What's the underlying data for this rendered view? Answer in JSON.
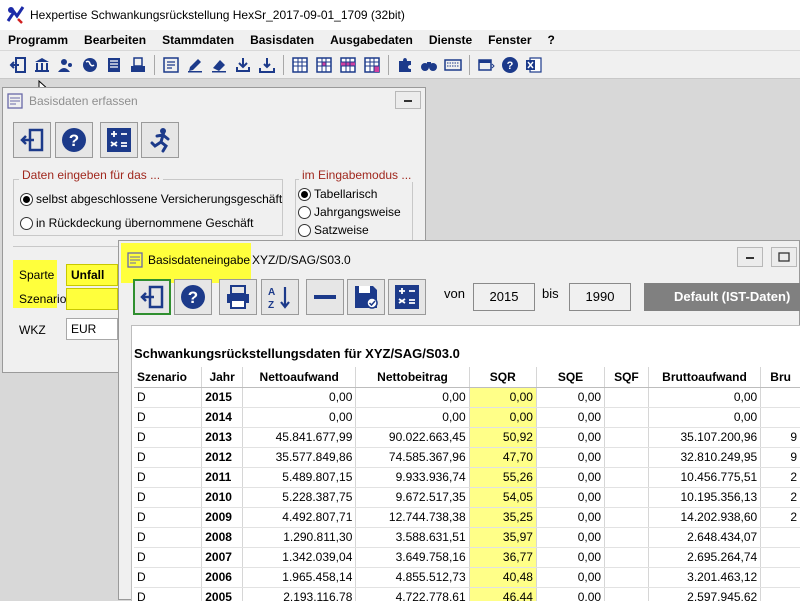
{
  "app": {
    "title": "Hexpertise Schwankungsrückstellung HexSr_2017-09-01_1709 (32bit)"
  },
  "menu": [
    "Programm",
    "Bearbeiten",
    "Stammdaten",
    "Basisdaten",
    "Ausgabedaten",
    "Dienste",
    "Fenster",
    "?"
  ],
  "toolbar": {
    "icons": [
      "exit-icon",
      "bank-icon",
      "users-icon",
      "globe-icon",
      "document-list-icon",
      "printer-doc-icon",
      "form-edit-icon",
      "pencil-edit-icon",
      "eraser-icon",
      "download-icon",
      "import-icon",
      "grid-icon",
      "grid-pink-icon",
      "grid-alt-icon",
      "grid-check-icon",
      "puzzle-icon",
      "binoculars-icon",
      "keyboard-icon",
      "window-icon",
      "help-icon",
      "excel-icon"
    ]
  },
  "win1": {
    "title": "Basisdaten erfassen",
    "group_left": {
      "title": "Daten eingeben für das ...",
      "opt1": "selbst abgeschlossene Versicherungsgeschäft",
      "opt2": "in Rückdeckung übernommene Geschäft",
      "selected": 1
    },
    "group_right": {
      "title": "im Eingabemodus ...",
      "opt1": "Tabellarisch",
      "opt2": "Jahrgangsweise",
      "opt3": "Satzweise",
      "selected": 1
    },
    "fields": {
      "sparte_label": "Sparte",
      "sparte_value": "Unfall",
      "szenario_label": "Szenario",
      "szenario_value": "",
      "wkz_label": "WKZ",
      "wkz_value": "EUR"
    }
  },
  "win2": {
    "title": "Basisdateneingabe",
    "path": "XYZ/D/SAG/S03.0",
    "range": {
      "von_label": "von",
      "von": "2015",
      "bis_label": "bis",
      "bis": "1990"
    },
    "default_label": "Default (IST-Daten)",
    "grid_title": "Schwankungsrückstellungsdaten für XYZ/SAG/S03.0",
    "columns": [
      "Szenario",
      "Jahr",
      "Nettoaufwand",
      "Nettobeitrag",
      "SQR",
      "SQE",
      "SQF",
      "Bruttoaufwand",
      "Bru"
    ],
    "rows": [
      [
        "D",
        "2015",
        "0,00",
        "0,00",
        "0,00",
        "0,00",
        "",
        "0,00",
        ""
      ],
      [
        "D",
        "2014",
        "0,00",
        "0,00",
        "0,00",
        "0,00",
        "",
        "0,00",
        ""
      ],
      [
        "D",
        "2013",
        "45.841.677,99",
        "90.022.663,45",
        "50,92",
        "0,00",
        "",
        "35.107.200,96",
        "9"
      ],
      [
        "D",
        "2012",
        "35.577.849,86",
        "74.585.367,96",
        "47,70",
        "0,00",
        "",
        "32.810.249,95",
        "9"
      ],
      [
        "D",
        "2011",
        "5.489.807,15",
        "9.933.936,74",
        "55,26",
        "0,00",
        "",
        "10.456.775,51",
        "2"
      ],
      [
        "D",
        "2010",
        "5.228.387,75",
        "9.672.517,35",
        "54,05",
        "0,00",
        "",
        "10.195.356,13",
        "2"
      ],
      [
        "D",
        "2009",
        "4.492.807,71",
        "12.744.738,38",
        "35,25",
        "0,00",
        "",
        "14.202.938,60",
        "2"
      ],
      [
        "D",
        "2008",
        "1.290.811,30",
        "3.588.631,51",
        "35,97",
        "0,00",
        "",
        "2.648.434,07",
        ""
      ],
      [
        "D",
        "2007",
        "1.342.039,04",
        "3.649.758,16",
        "36,77",
        "0,00",
        "",
        "2.695.264,74",
        ""
      ],
      [
        "D",
        "2006",
        "1.965.458,14",
        "4.855.512,73",
        "40,48",
        "0,00",
        "",
        "3.201.463,12",
        ""
      ],
      [
        "D",
        "2005",
        "2.193.116,78",
        "4.722.778,61",
        "46,44",
        "0,00",
        "",
        "2.597.945,62",
        ""
      ]
    ]
  }
}
